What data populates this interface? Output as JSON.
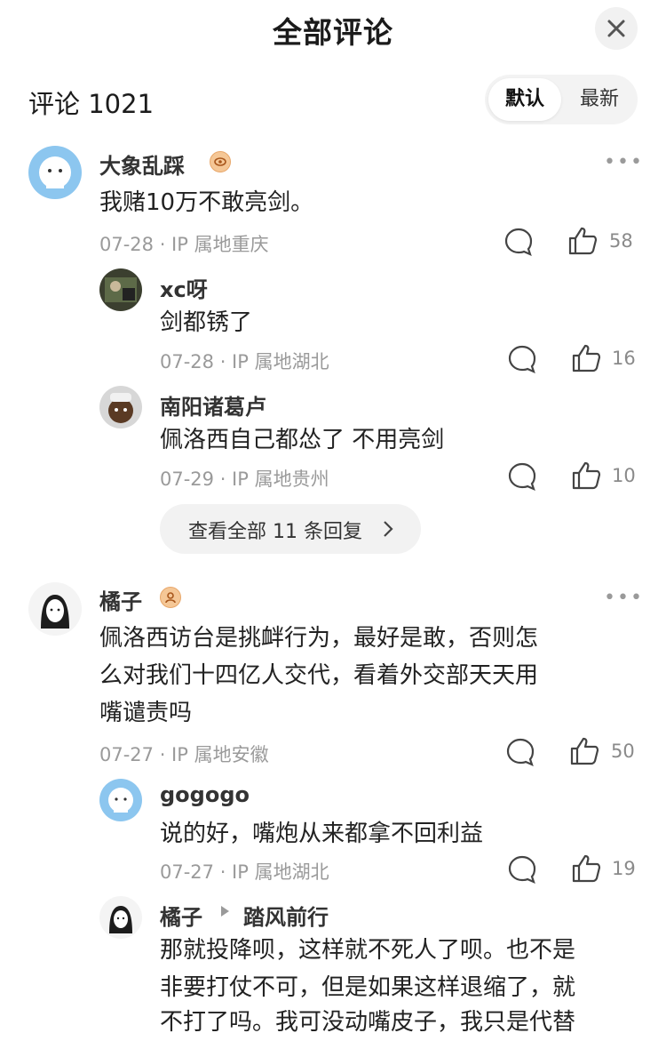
{
  "header": {
    "title": "全部评论",
    "close_icon": "close-icon"
  },
  "toolbar": {
    "count_label": "评论 1021",
    "sort_default": "默认",
    "sort_latest": "最新"
  },
  "comments": [
    {
      "name": "大象乱踩",
      "text": "我赌10万不敢亮剑。",
      "meta": "07-28 · IP 属地重庆",
      "likes": "58",
      "replies": [
        {
          "name": "xc呀",
          "text": "剑都锈了",
          "meta": "07-28 · IP 属地湖北",
          "likes": "16"
        },
        {
          "name": "南阳诸葛卢",
          "text": "佩洛西自己都怂了 不用亮剑",
          "meta": "07-29 · IP 属地贵州",
          "likes": "10"
        }
      ],
      "view_all": "查看全部 11 条回复"
    },
    {
      "name": "橘子",
      "text_lines": [
        "佩洛西访台是挑衅行为，最好是敢，否则怎",
        "么对我们十四亿人交代，看着外交部天天用",
        "嘴谴责吗"
      ],
      "meta": "07-27 · IP 属地安徽",
      "likes": "50",
      "replies": [
        {
          "name": "gogogo",
          "text": "说的好，嘴炮从来都拿不回利益",
          "meta": "07-27 · IP 属地湖北",
          "likes": "19"
        },
        {
          "name": "橘子",
          "reply_to": "踏风前行",
          "text_lines": [
            "那就投降呗，这样就不死人了呗。也不是",
            "非要打仗不可，但是如果这样退缩了，就",
            "不打了吗。我可没动嘴皮子，我只是代替"
          ]
        }
      ]
    }
  ],
  "colors": {
    "badge": "#f5c796",
    "pill_bg": "#f2f2f2",
    "meta_text": "#9a9a9a"
  }
}
